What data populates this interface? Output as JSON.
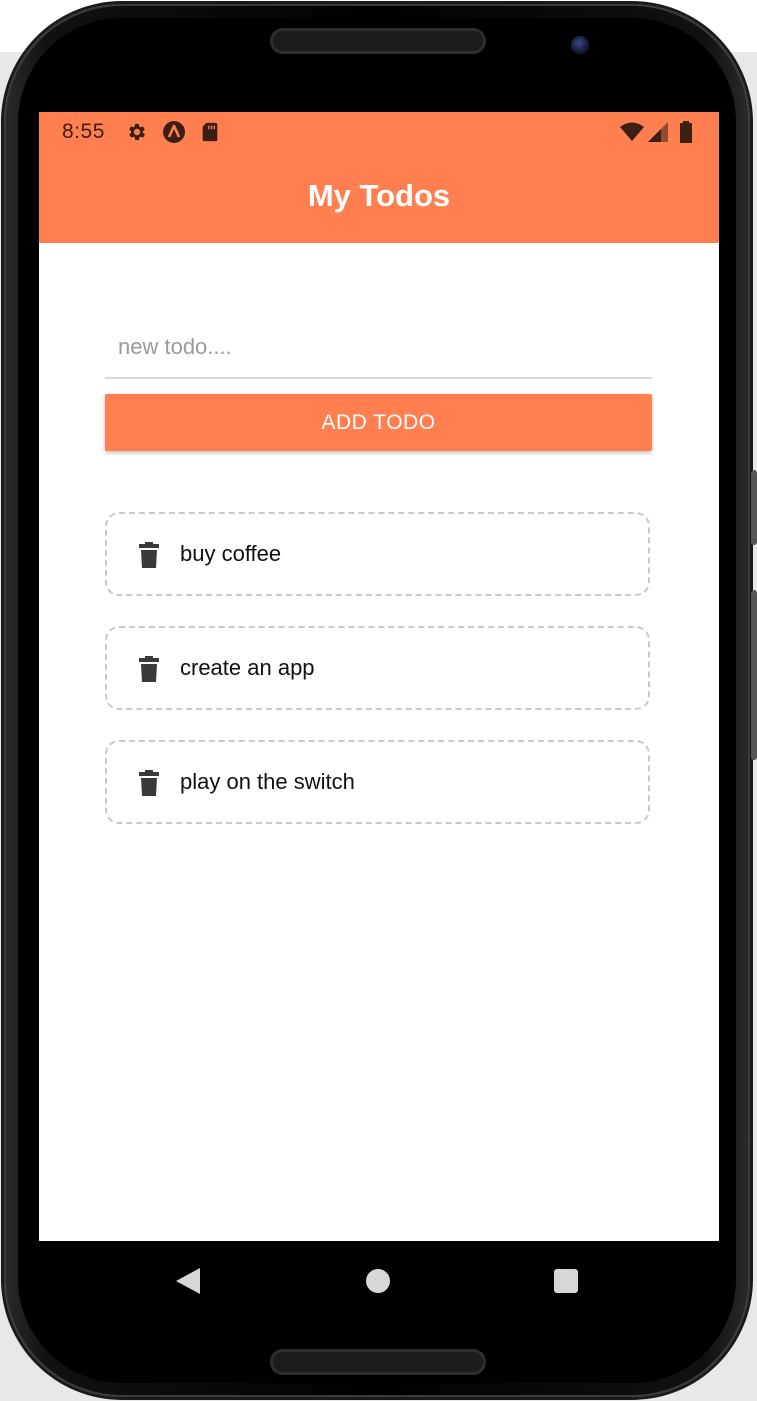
{
  "status_bar": {
    "time": "8:55",
    "icons": [
      "settings-icon",
      "app-notification-icon",
      "sd-card-icon",
      "wifi-icon",
      "cellular-signal-icon",
      "battery-icon"
    ]
  },
  "app_bar": {
    "title": "My Todos",
    "color": "#ff7f50"
  },
  "new_todo": {
    "value": "",
    "placeholder": "new todo...."
  },
  "add_button": {
    "label": "ADD TODO"
  },
  "todos": [
    {
      "text": "buy coffee",
      "icon": "trash-icon"
    },
    {
      "text": "create an app",
      "icon": "trash-icon"
    },
    {
      "text": "play on the switch",
      "icon": "trash-icon"
    }
  ],
  "nav_bar": {
    "buttons": [
      "back-icon",
      "home-icon",
      "recent-apps-icon"
    ]
  }
}
